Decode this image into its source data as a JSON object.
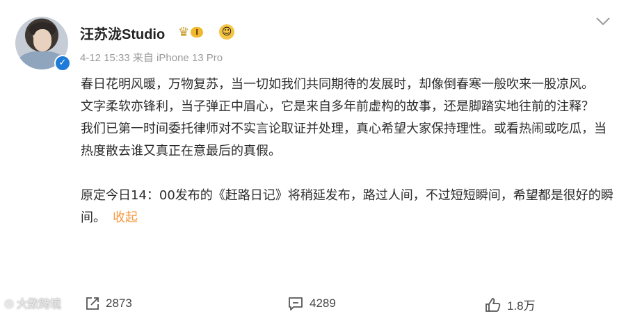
{
  "post": {
    "author": "汪苏泷Studio",
    "vip_level": "I",
    "meta": "4-12 15:33  来自 iPhone 13 Pro",
    "paragraphs": [
      "春日花明风暖，万物复苏，当一切如我们共同期待的发展时，却像倒春寒一般吹来一股凉风。",
      "文字柔软亦锋利，当子弹正中眉心，它是来自多年前虚构的故事，还是脚踏实地往前的注释？",
      "我们已第一时间委托律师对不实言论取证并处理，真心希望大家保持理性。或看热闹或吃瓜，当热度散去谁又真正在意最后的真假。"
    ],
    "last_paragraph": "原定今日14：00发布的《赶路日记》将稍延发布，路过人间，不过短短瞬间，希望都是很好的瞬间。",
    "collapse_label": "收起"
  },
  "actions": {
    "repost_count": "2873",
    "comment_count": "4289",
    "like_count": "1.8万"
  },
  "watermark": "大数跨境",
  "icons": {
    "verified": "verified-check-icon",
    "crown": "vip-crown-icon",
    "more": "chevron-down-icon",
    "repost": "repost-icon",
    "comment": "comment-icon",
    "like": "thumbs-up-icon"
  },
  "colors": {
    "accent": "#f59b43",
    "verified": "#1e7bd8",
    "meta_text": "#9a9a9a"
  }
}
